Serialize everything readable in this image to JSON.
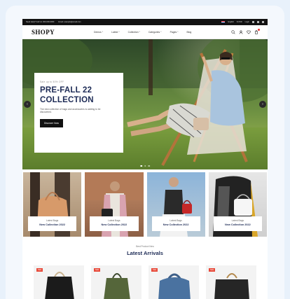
{
  "topbar": {
    "phone": "Need Help? Call Us: 000-000-0000",
    "email": "Email: example@email.com",
    "language": "English",
    "currency": "$ USD",
    "login": "Login"
  },
  "brand": {
    "logo": "SHOPY"
  },
  "nav": {
    "items": [
      "Demos",
      "Latest",
      "Collection",
      "Categories",
      "Pages",
      "Blog"
    ]
  },
  "header_icons": [
    "search-icon",
    "user-icon",
    "heart-icon",
    "cart-icon"
  ],
  "hero": {
    "kicker": "Sale up to 50% OFF",
    "title_line1": "PRE-FALL 22",
    "title_line2": "COLLECTION",
    "description": "The new collection of bags and accessories is waiting to be discovered.",
    "button": "Discover Now",
    "prev": "‹",
    "next": "›"
  },
  "categories": [
    {
      "label": "Latest Bags",
      "title": "New Collection 2022"
    },
    {
      "label": "Latest Bags",
      "title": "New Collection 2022"
    },
    {
      "label": "Latest Bags",
      "title": "New Collection 2022"
    },
    {
      "label": "Latest Bags",
      "title": "New Collection 2022"
    }
  ],
  "arrivals": {
    "kicker": "Best Product New",
    "title": "Latest Arrivals",
    "sale_badge": "Sale"
  },
  "colors": {
    "navy": "#1c2a55",
    "sale": "#e84a3a",
    "topbar": "#121212"
  }
}
